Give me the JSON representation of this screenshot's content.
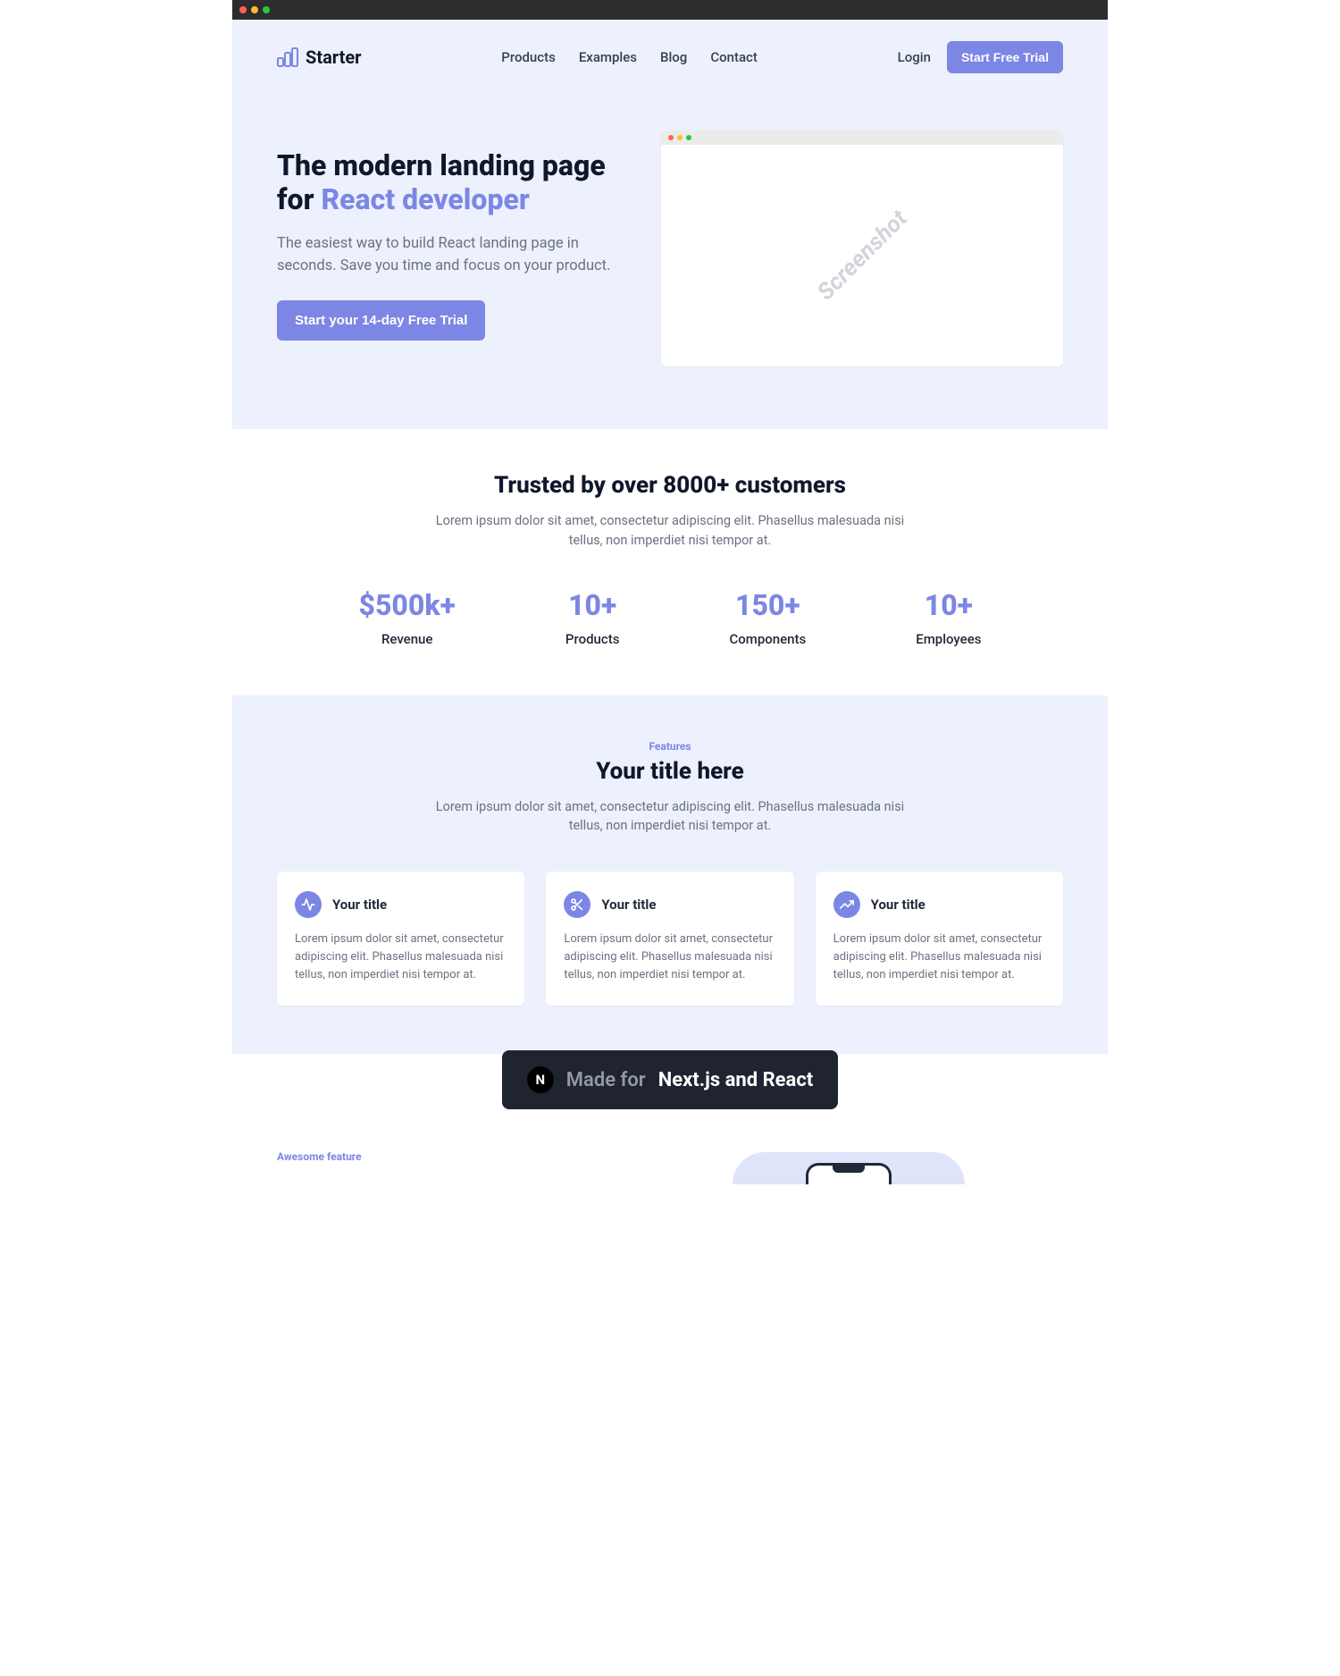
{
  "brand": {
    "name": "Starter"
  },
  "nav": {
    "links": [
      {
        "label": "Products"
      },
      {
        "label": "Examples"
      },
      {
        "label": "Blog"
      },
      {
        "label": "Contact"
      }
    ],
    "login": "Login",
    "cta": "Start Free Trial"
  },
  "hero": {
    "title_line1": "The modern landing page",
    "title_line2_prefix": "for ",
    "title_line2_accent": "React developer",
    "subtitle": "The easiest way to build React landing page in seconds. Save you time and focus on your product.",
    "cta": "Start your 14-day Free Trial",
    "screenshot_placeholder": "Screenshot"
  },
  "stats": {
    "title": "Trusted by over 8000+ customers",
    "subtitle": "Lorem ipsum dolor sit amet, consectetur adipiscing elit. Phasellus malesuada nisi tellus, non imperdiet nisi tempor at.",
    "items": [
      {
        "value": "$500k+",
        "label": "Revenue"
      },
      {
        "value": "10+",
        "label": "Products"
      },
      {
        "value": "150+",
        "label": "Components"
      },
      {
        "value": "10+",
        "label": "Employees"
      }
    ]
  },
  "features": {
    "eyebrow": "Features",
    "title": "Your title here",
    "subtitle": "Lorem ipsum dolor sit amet, consectetur adipiscing elit. Phasellus malesuada nisi tellus, non imperdiet nisi tempor at.",
    "cards": [
      {
        "title": "Your title",
        "icon": "activity-icon",
        "desc": "Lorem ipsum dolor sit amet, consectetur adipiscing elit. Phasellus malesuada nisi tellus, non imperdiet nisi tempor at."
      },
      {
        "title": "Your title",
        "icon": "scissors-icon",
        "desc": "Lorem ipsum dolor sit amet, consectetur adipiscing elit. Phasellus malesuada nisi tellus, non imperdiet nisi tempor at."
      },
      {
        "title": "Your title",
        "icon": "trending-up-icon",
        "desc": "Lorem ipsum dolor sit amet, consectetur adipiscing elit. Phasellus malesuada nisi tellus, non imperdiet nisi tempor at."
      }
    ]
  },
  "badge": {
    "prefix": "Made for",
    "main": "Next.js and React"
  },
  "awesome": {
    "eyebrow": "Awesome feature"
  },
  "colors": {
    "accent": "#7c86e4",
    "hero_bg": "#edf1fd"
  }
}
